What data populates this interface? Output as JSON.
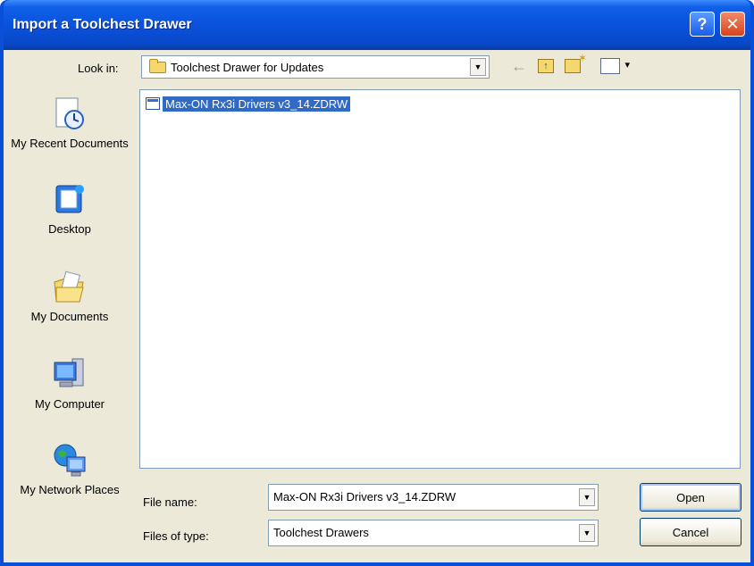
{
  "window": {
    "title": "Import a Toolchest Drawer",
    "help_label": "?",
    "close_label": "✕"
  },
  "toolbar": {
    "look_in_label": "Look in:",
    "look_in_value": "Toolchest Drawer for Updates",
    "back_label": "←"
  },
  "places": [
    {
      "label": "My Recent Documents",
      "icon": "recent-documents-icon"
    },
    {
      "label": "Desktop",
      "icon": "desktop-icon"
    },
    {
      "label": "My Documents",
      "icon": "my-documents-icon"
    },
    {
      "label": "My Computer",
      "icon": "my-computer-icon"
    },
    {
      "label": "My Network Places",
      "icon": "network-places-icon"
    }
  ],
  "files": [
    {
      "name": "Max-ON Rx3i Drivers v3_14.ZDRW",
      "selected": true
    }
  ],
  "form": {
    "file_name_label": "File name:",
    "file_name_value": "Max-ON Rx3i Drivers v3_14.ZDRW",
    "file_type_label": "Files of type:",
    "file_type_value": "Toolchest Drawers"
  },
  "buttons": {
    "open": "Open",
    "cancel": "Cancel"
  },
  "colors": {
    "titlebar": "#0a52dc",
    "dialog_bg": "#ece9d8",
    "selection": "#316ac5",
    "close_button": "#d8431c"
  }
}
